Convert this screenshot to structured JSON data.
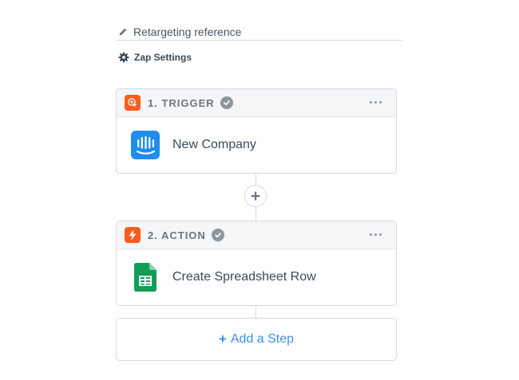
{
  "zap": {
    "title": "Retargeting reference",
    "settings_label": "Zap Settings"
  },
  "steps": [
    {
      "label": "1. TRIGGER",
      "app_event": "New Company",
      "app_icon": "intercom-icon",
      "step_icon": "trigger-icon"
    },
    {
      "label": "2. ACTION",
      "app_event": "Create Spreadsheet Row",
      "app_icon": "google-sheets-icon",
      "step_icon": "lightning-icon"
    }
  ],
  "add_step": {
    "plus": "+",
    "label": "Add a Step"
  },
  "colors": {
    "accent": "#3d8ff0",
    "step_orange": "#ff5a1f",
    "intercom_blue": "#1f8ded",
    "sheets_green": "#0f9d58",
    "check_gray": "#8d969e"
  }
}
